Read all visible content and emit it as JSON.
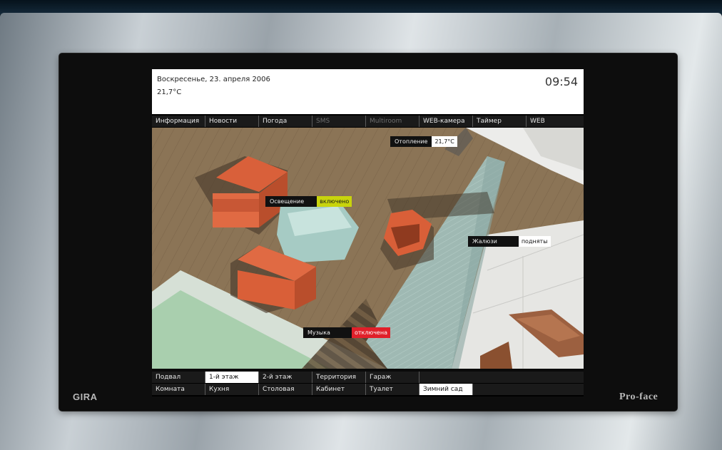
{
  "brands": {
    "left": "GIRA",
    "right": "Pro-face"
  },
  "header": {
    "date": "Воскресенье, 23. апреля 2006",
    "temperature": "21,7°C",
    "time": "09:54"
  },
  "top_nav": [
    {
      "label": "Информация",
      "state": "normal"
    },
    {
      "label": "Новости",
      "state": "normal"
    },
    {
      "label": "Погода",
      "state": "normal"
    },
    {
      "label": "SMS",
      "state": "dim"
    },
    {
      "label": "Multiroom",
      "state": "dim"
    },
    {
      "label": "WEB-камера",
      "state": "normal"
    },
    {
      "label": "Таймер",
      "state": "normal"
    },
    {
      "label": "WEB",
      "state": "normal"
    }
  ],
  "status_tags": [
    {
      "key": "Отопление",
      "value": "21,7°C",
      "value_color": "#ffffff",
      "value_text": "#111111"
    },
    {
      "key": "Освещение",
      "value": "включено",
      "value_color": "#c8d40c",
      "value_text": "#1a1a1a"
    },
    {
      "key": "Жалюзи",
      "value": "подняты",
      "value_color": "#ffffff",
      "value_text": "#111111"
    },
    {
      "key": "Музыка",
      "value": "отключена",
      "value_color": "#e0202a",
      "value_text": "#ffffff"
    }
  ],
  "floors_nav": [
    {
      "label": "Подвал",
      "selected": false
    },
    {
      "label": "1-й этаж",
      "selected": true
    },
    {
      "label": "2-й этаж",
      "selected": false
    },
    {
      "label": "Территория",
      "selected": false
    },
    {
      "label": "Гараж",
      "selected": false
    }
  ],
  "rooms_nav": [
    {
      "label": "Комната",
      "selected": false
    },
    {
      "label": "Кухня",
      "selected": false
    },
    {
      "label": "Столовая",
      "selected": false
    },
    {
      "label": "Кабинет",
      "selected": false
    },
    {
      "label": "Туалет",
      "selected": false
    },
    {
      "label": "Зимний сад",
      "selected": true
    }
  ]
}
